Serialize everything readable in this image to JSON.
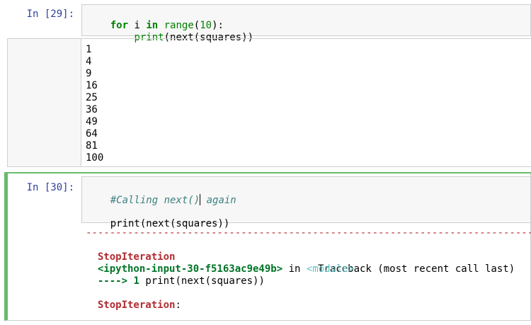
{
  "cell29": {
    "prompt": "In [29]:",
    "line1": {
      "kw_for": "for",
      "i": " i ",
      "kw_in": "in",
      "sp": " ",
      "range": "range",
      "open": "(",
      "ten": "10",
      "close": "):"
    },
    "line2": {
      "indent": "    ",
      "print": "print",
      "rest": "(next(squares))"
    },
    "outputs": [
      "1",
      "4",
      "9",
      "16",
      "25",
      "36",
      "49",
      "64",
      "81",
      "100"
    ]
  },
  "cell30": {
    "prompt": "In [30]:",
    "comment_before_caret": "#Calling next()",
    "comment_after_caret": " again",
    "print_line": "print(next(squares))",
    "traceback": {
      "dashes": "---------------------------------------------------------------------------",
      "error_name": "StopIteration",
      "traceback_header": "Traceback (most recent call last)",
      "input_ref": "<ipython-input-30-f5163ac9e49b>",
      "in_word": " in ",
      "module": "<module>",
      "arrow": "---->",
      "line_no": " 1 ",
      "call": "print(next(squares))",
      "final_error": "StopIteration",
      "final_colon": ":"
    }
  },
  "colors": {
    "prompt": "#303f9f",
    "selected_border": "#66bb6a",
    "error_red": "#b22b31",
    "keyword_green": "#008000"
  }
}
